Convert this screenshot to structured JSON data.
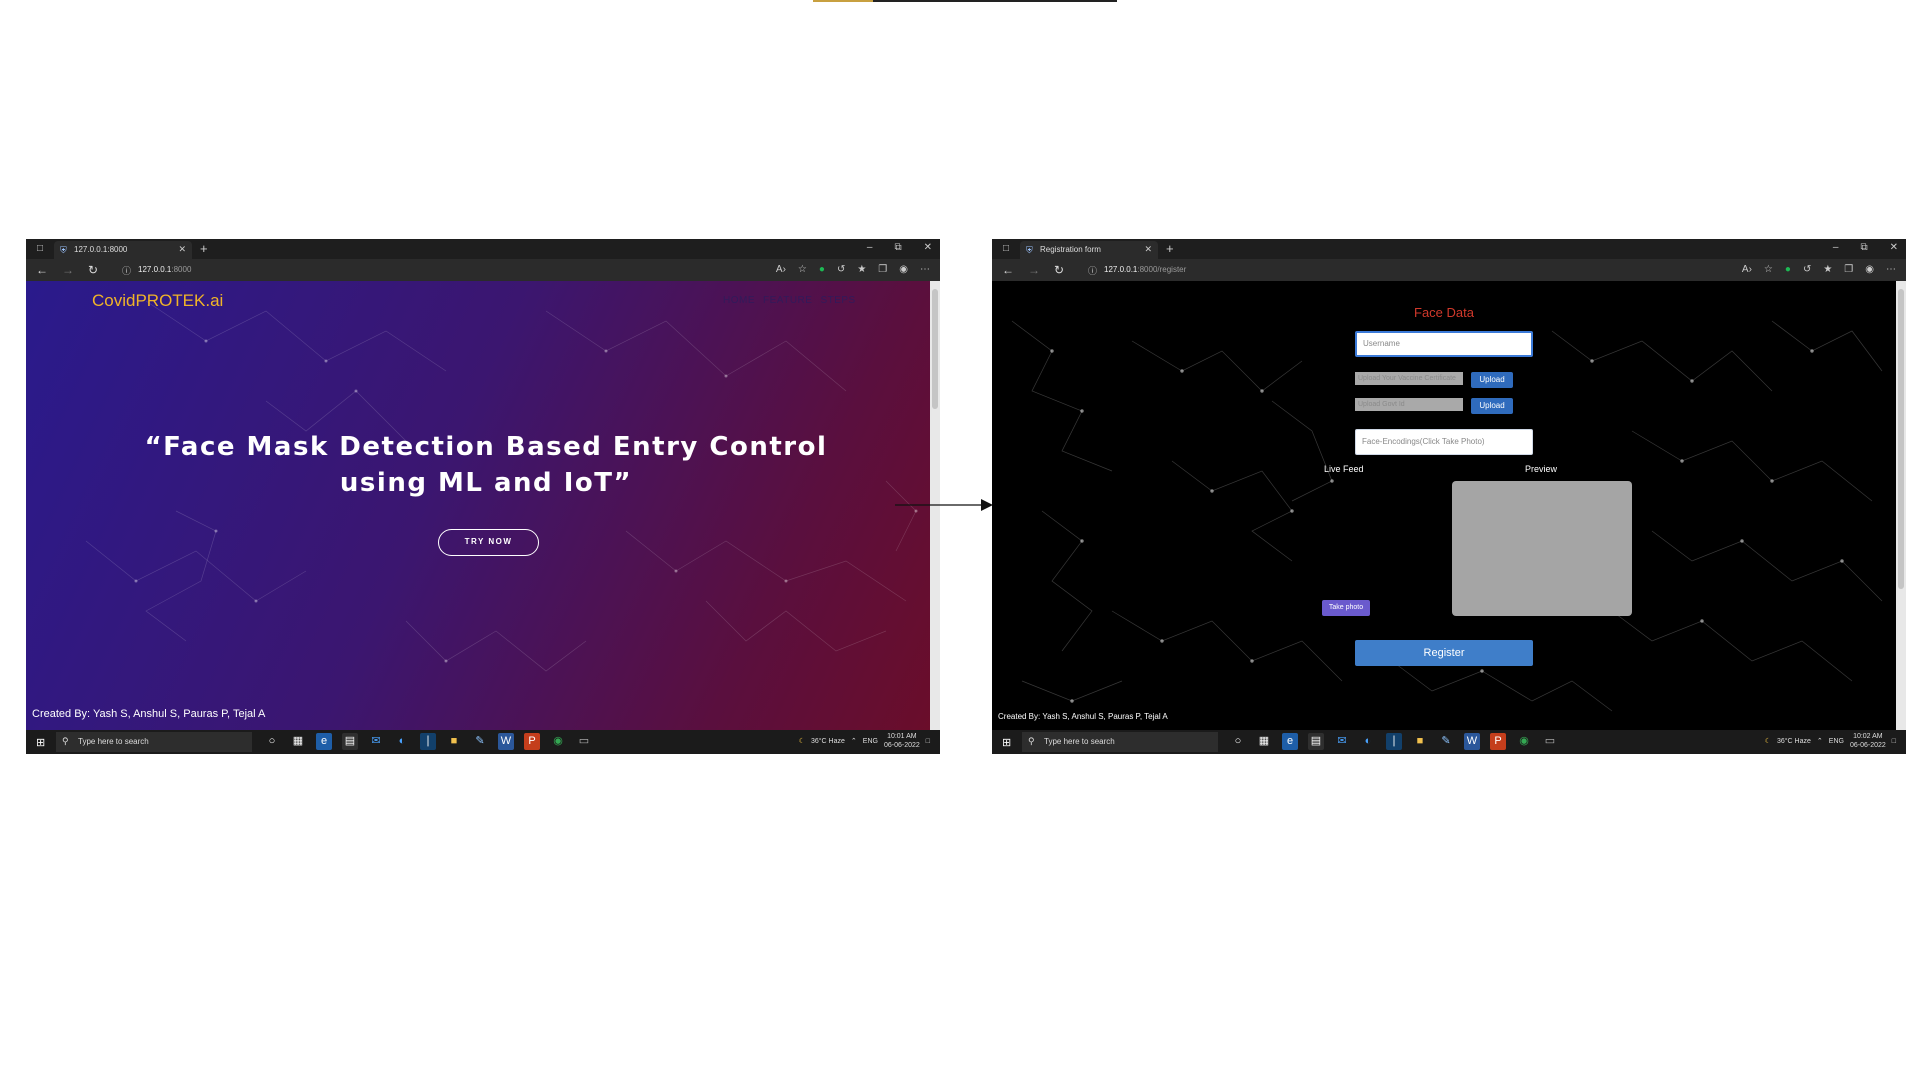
{
  "left": {
    "window": {
      "tab_title": "127.0.0.1:8000",
      "url_host": "127.0.0.1",
      "url_rest": ":8000"
    },
    "page": {
      "brand": "CovidPROTEK.ai",
      "nav": [
        "HOME",
        "FEATURE",
        "STEPS"
      ],
      "headline": "“Face Mask Detection Based Entry Control using ML and IoT”",
      "cta": "TRY NOW",
      "credits": "Created By: Yash S, Anshul S, Pauras P, Tejal A"
    },
    "taskbar": {
      "search_placeholder": "Type here to search",
      "weather": "36°C  Haze",
      "lang": "ENG",
      "time": "10:01 AM",
      "date": "06-06-2022"
    }
  },
  "right": {
    "window": {
      "tab_title": "Registration form",
      "url_host": "127.0.0.1",
      "url_rest": ":8000/register"
    },
    "page": {
      "title": "Face Data",
      "username_placeholder": "Username",
      "vaccine_file_label": "Upload Your Vaccine Certificate",
      "govt_file_label": "Upload Govt Id",
      "upload_label": "Upload",
      "encodings_placeholder": "Face-Encodings(Click Take Photo)",
      "live_feed_label": "Live Feed",
      "preview_label": "Preview",
      "take_photo_label": "Take photo",
      "register_label": "Register",
      "credits": "Created By: Yash S, Anshul S, Pauras P, Tejal A"
    },
    "taskbar": {
      "search_placeholder": "Type here to search",
      "weather": "36°C  Haze",
      "lang": "ENG",
      "time": "10:02 AM",
      "date": "06-06-2022"
    }
  },
  "icons": [
    "browser-tab-actions-icon",
    "favicon-shield-icon",
    "close-tab-icon",
    "new-tab-icon",
    "minimize-icon",
    "restore-icon",
    "close-window-icon",
    "back-icon",
    "forward-icon",
    "refresh-icon",
    "site-info-icon",
    "read-aloud-icon",
    "favorites-add-icon",
    "extension-icon",
    "sync-icon",
    "favorites-icon",
    "collections-icon",
    "profile-icon",
    "more-icon",
    "windows-start-icon",
    "search-icon",
    "cortana-icon",
    "task-view-icon",
    "weather-icon",
    "notifications-icon",
    "arrow-icon"
  ],
  "colors": {
    "brand": "#f0b428",
    "face_data_title": "#d0392b",
    "upload_button": "#2f6bbd",
    "take_photo_button": "#6a5acd",
    "register_button": "#3f7ec9"
  }
}
